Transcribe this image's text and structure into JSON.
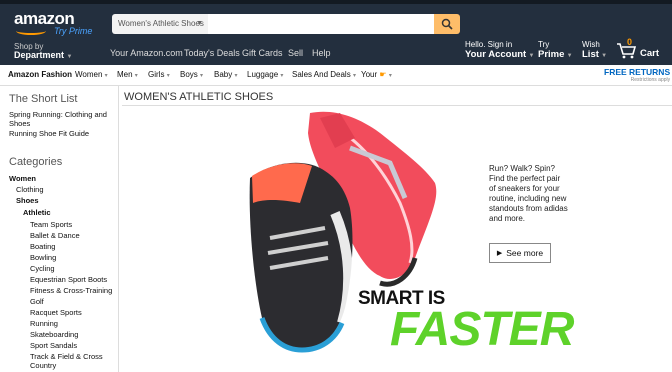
{
  "header": {
    "logo": "amazon",
    "try_prime": "Try Prime",
    "search_category": "Women's Athletic Shoes",
    "search_value": "",
    "shop_by_line1": "Shop by",
    "shop_by_line2": "Department",
    "nav_links": [
      "Your Amazon.com",
      "Today's Deals",
      "Gift Cards",
      "Sell",
      "Help"
    ],
    "account_line1": "Hello. Sign in",
    "account_line2": "Your Account",
    "prime_line1": "Try",
    "prime_line2": "Prime",
    "list_line1": "Wish",
    "list_line2": "List",
    "cart_label": "Cart",
    "cart_count": "0"
  },
  "subnav": {
    "items": [
      "Amazon Fashion",
      "Women",
      "Men",
      "Girls",
      "Boys",
      "Baby",
      "Luggage",
      "Sales And Deals",
      "Your"
    ],
    "free_returns": "FREE RETURNS",
    "restrictions": "Restrictions apply"
  },
  "sidebar": {
    "shortlist_title": "The Short List",
    "shortlist": [
      "Spring Running: Clothing and Shoes",
      "Running Shoe Fit Guide"
    ],
    "categories_title": "Categories",
    "categories": [
      {
        "label": "Women",
        "bold": true
      },
      {
        "label": "Clothing",
        "bold": false
      },
      {
        "label": "Shoes",
        "bold": true
      },
      {
        "label": "Athletic",
        "bold": true
      },
      {
        "label": "Team Sports",
        "bold": false
      },
      {
        "label": "Ballet & Dance",
        "bold": false
      },
      {
        "label": "Boating",
        "bold": false
      },
      {
        "label": "Bowling",
        "bold": false
      },
      {
        "label": "Cycling",
        "bold": false
      },
      {
        "label": "Equestrian Sport Boots",
        "bold": false
      },
      {
        "label": "Fitness & Cross-Training",
        "bold": false
      },
      {
        "label": "Golf",
        "bold": false
      },
      {
        "label": "Racquet Sports",
        "bold": false
      },
      {
        "label": "Running",
        "bold": false
      },
      {
        "label": "Skateboarding",
        "bold": false
      },
      {
        "label": "Sport Sandals",
        "bold": false
      },
      {
        "label": "Track & Field & Cross Country",
        "bold": false
      }
    ]
  },
  "main": {
    "title": "WOMEN'S ATHLETIC SHOES",
    "blurb": "Run? Walk? Spin? Find the perfect pair of sneakers for your routine, including new standouts from adidas and more.",
    "see_more": "See more",
    "headline1": "SMART IS",
    "headline2": "FASTER"
  },
  "colors": {
    "header_bg": "#232f3e",
    "accent": "#f90",
    "search_button": "#febd69",
    "headline_green": "#5ed22a"
  }
}
